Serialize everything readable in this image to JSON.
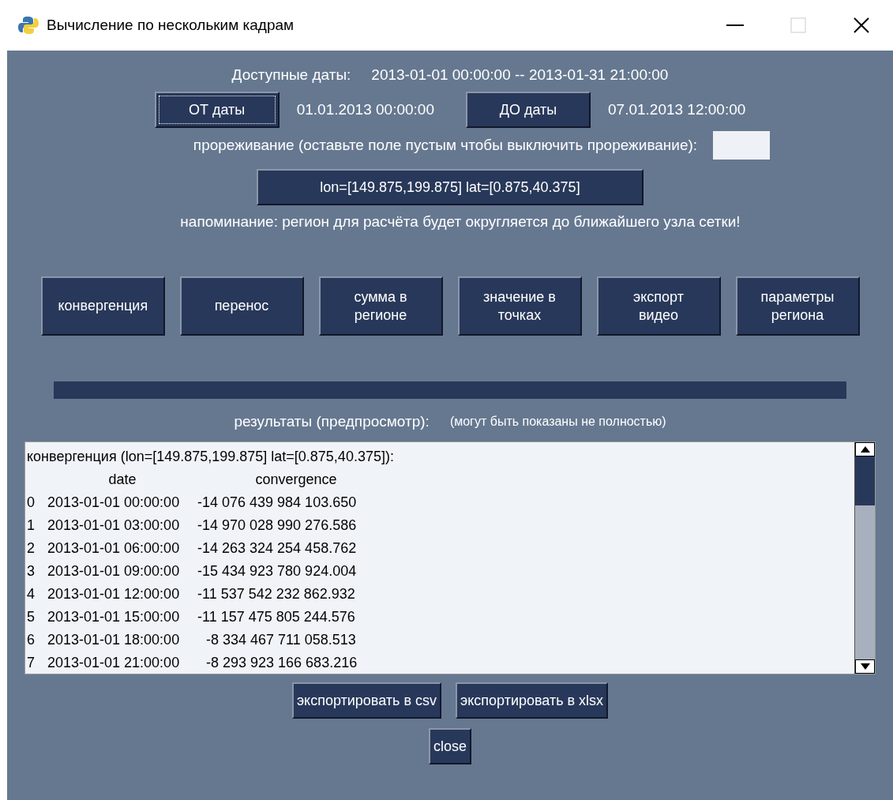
{
  "window": {
    "title": "Вычисление по нескольким кадрам"
  },
  "available": {
    "label": "Доступные даты:",
    "value": "2013-01-01 00:00:00 -- 2013-01-31 21:00:00"
  },
  "date_range": [
    {
      "button": "ОТ даты",
      "focused": true,
      "value": "01.01.2013 00:00:00"
    },
    {
      "button": "ДО даты",
      "focused": false,
      "value": "07.01.2013 12:00:00"
    }
  ],
  "thinning": {
    "label": "прореживание (оставьте поле пустым чтобы выключить прореживание):"
  },
  "region_button": "lon=[149.875,199.875] lat=[0.875,40.375]",
  "reminder": "напоминание: регион для расчёта будет округляется до ближайшего узла сетки!",
  "actions": [
    "конвергенция",
    "перенос",
    "сумма в регионе",
    "значение в точках",
    "экспорт видео",
    "параметры региона"
  ],
  "results": {
    "label": "результаты (предпросмотр):",
    "note": "(могут быть показаны не полностью)",
    "title": "конвергенция (lon=[149.875,199.875] lat=[0.875,40.375]):",
    "columns": [
      "date",
      "convergence"
    ],
    "rows": [
      {
        "index": "0",
        "date": "2013-01-01 00:00:00",
        "value": "-14 076 439 984 103.650"
      },
      {
        "index": "1",
        "date": "2013-01-01 03:00:00",
        "value": "-14 970 028 990 276.586"
      },
      {
        "index": "2",
        "date": "2013-01-01 06:00:00",
        "value": "-14 263 324 254 458.762"
      },
      {
        "index": "3",
        "date": "2013-01-01 09:00:00",
        "value": "-15 434 923 780 924.004"
      },
      {
        "index": "4",
        "date": "2013-01-01 12:00:00",
        "value": "-11 537 542 232 862.932"
      },
      {
        "index": "5",
        "date": "2013-01-01 15:00:00",
        "value": "-11 157 475 805 244.576"
      },
      {
        "index": "6",
        "date": "2013-01-01 18:00:00",
        "value": "-8 334 467 711 058.513"
      },
      {
        "index": "7",
        "date": "2013-01-01 21:00:00",
        "value": "-8 293 923 166 683.216"
      }
    ]
  },
  "export_buttons": [
    "экспортировать в csv",
    "экспортировать в xlsx"
  ],
  "close_button": "close"
}
